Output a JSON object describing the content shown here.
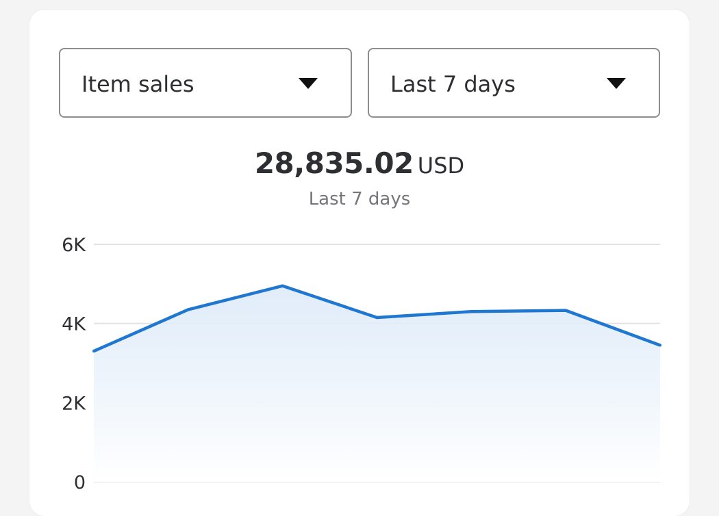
{
  "filters": {
    "metric": {
      "label": "Item sales",
      "icon": "caret-down-icon"
    },
    "range": {
      "label": "Last 7 days",
      "icon": "caret-down-icon"
    }
  },
  "summary": {
    "amount": "28,835.02",
    "currency": "USD",
    "period": "Last 7 days"
  },
  "colors": {
    "line": "#1f77d0",
    "fill_top": "#dbe9f8",
    "grid": "#e2e3e5"
  },
  "chart_data": {
    "type": "area",
    "title": "",
    "xlabel": "",
    "ylabel": "",
    "x": [
      1,
      2,
      3,
      4,
      5,
      6,
      7
    ],
    "series": [
      {
        "values": [
          3300,
          4350,
          4950,
          4150,
          4300,
          4330,
          3450
        ]
      }
    ],
    "ylim": [
      0,
      6000
    ],
    "yticks": [
      0,
      2000,
      4000,
      6000
    ],
    "ytick_labels": [
      "0",
      "2K",
      "4K",
      "6K"
    ],
    "grid": true,
    "legend": "none"
  }
}
